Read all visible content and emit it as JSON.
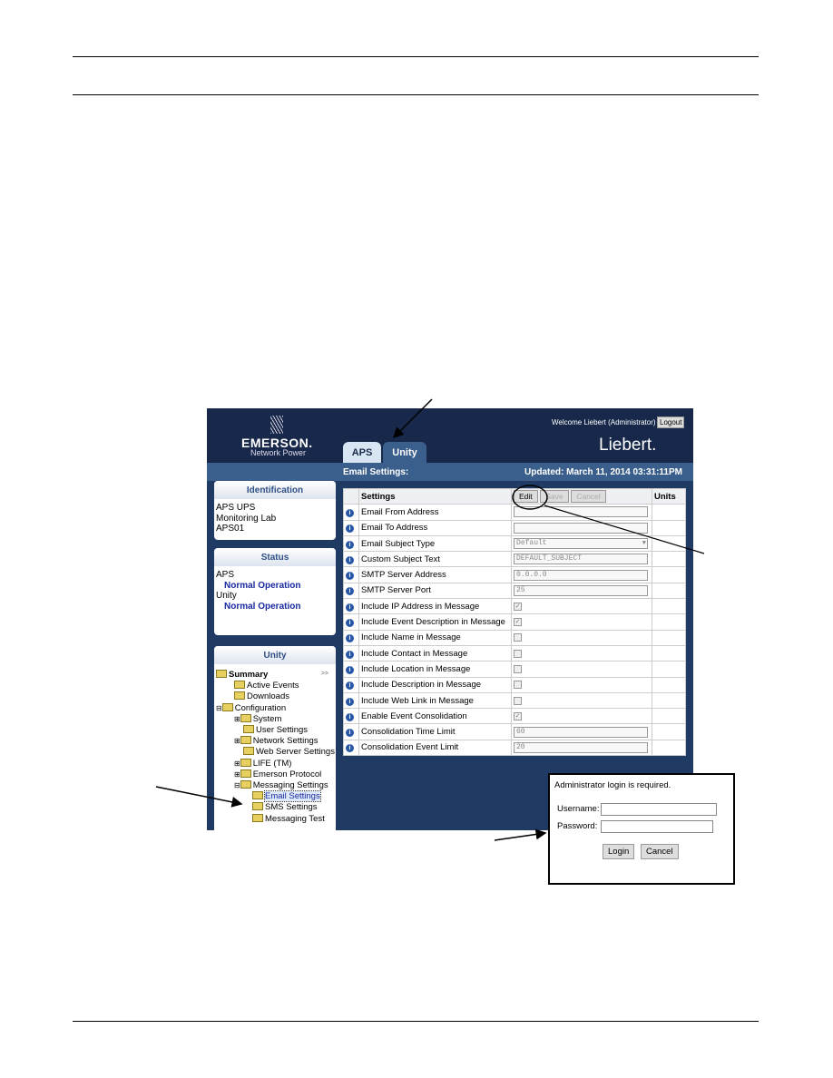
{
  "app": {
    "welcome": "Welcome Liebert (Administrator)",
    "logout": "Logout",
    "brand": "EMERSON.",
    "brand_sub": "Network Power",
    "liebert": "Liebert.",
    "tabs": [
      {
        "label": "APS"
      },
      {
        "label": "Unity"
      }
    ],
    "page_title": "Email Settings:",
    "updated": "Updated: March 11, 2014 03:31:11PM"
  },
  "identification": {
    "title": "Identification",
    "lines": [
      "APS UPS",
      "Monitoring Lab",
      "APS01"
    ]
  },
  "status": {
    "title": "Status",
    "items": [
      {
        "device": "APS",
        "state": "Normal Operation"
      },
      {
        "device": "Unity",
        "state": "Normal Operation"
      }
    ]
  },
  "tree": {
    "title": "Unity",
    "expand": ">>",
    "items": [
      "Summary",
      "Active Events",
      "Downloads",
      "Configuration",
      "System",
      "User Settings",
      "Network Settings",
      "Web Server Settings",
      "LIFE (TM)",
      "Emerson Protocol",
      "Messaging Settings",
      "Email Settings",
      "SMS Settings",
      "Messaging Test"
    ]
  },
  "table": {
    "header": "Settings",
    "edit": "Edit",
    "save": "Save",
    "cancel": "Cancel",
    "units": "Units",
    "rows": [
      {
        "label": "Email From Address",
        "type": "text",
        "value": ""
      },
      {
        "label": "Email To Address",
        "type": "text",
        "value": ""
      },
      {
        "label": "Email Subject Type",
        "type": "select",
        "value": "Default"
      },
      {
        "label": "Custom Subject Text",
        "type": "text",
        "value": "DEFAULT_SUBJECT"
      },
      {
        "label": "SMTP Server Address",
        "type": "text",
        "value": "0.0.0.0"
      },
      {
        "label": "SMTP Server Port",
        "type": "text",
        "value": "25"
      },
      {
        "label": "Include IP Address in Message",
        "type": "check",
        "checked": true
      },
      {
        "label": "Include Event Description in Message",
        "type": "check",
        "checked": true
      },
      {
        "label": "Include Name in Message",
        "type": "check",
        "checked": false
      },
      {
        "label": "Include Contact in Message",
        "type": "check",
        "checked": false
      },
      {
        "label": "Include Location in Message",
        "type": "check",
        "checked": false
      },
      {
        "label": "Include Description in Message",
        "type": "check",
        "checked": false
      },
      {
        "label": "Include Web Link in Message",
        "type": "check",
        "checked": false
      },
      {
        "label": "Enable Event Consolidation",
        "type": "check",
        "checked": true
      },
      {
        "label": "Consolidation Time Limit",
        "type": "text",
        "value": "60"
      },
      {
        "label": "Consolidation Event Limit",
        "type": "text",
        "value": "20"
      }
    ]
  },
  "login": {
    "message": "Administrator login is required.",
    "username_label": "Username:",
    "password_label": "Password:",
    "login": "Login",
    "cancel": "Cancel"
  }
}
